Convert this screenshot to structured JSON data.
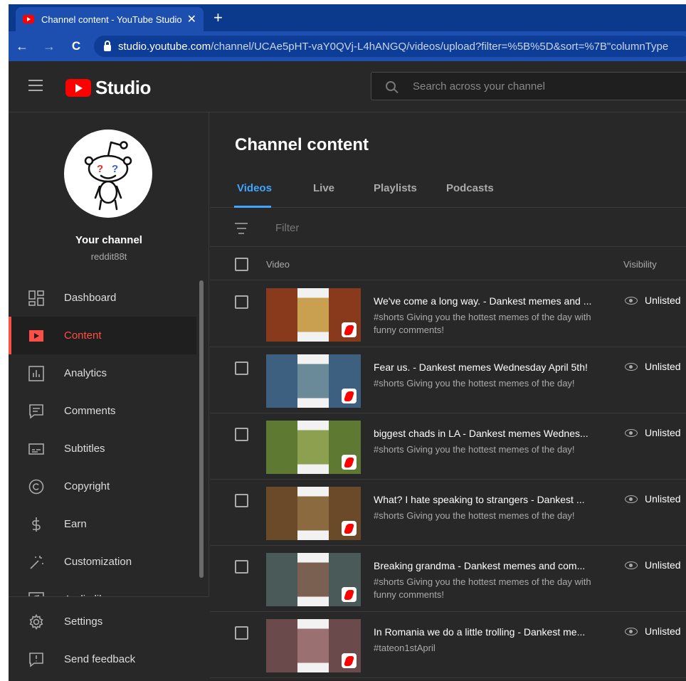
{
  "browser": {
    "tab_title": "Channel content - YouTube Studio",
    "tab_close": "✕",
    "new_tab": "+",
    "back": "←",
    "forward": "→",
    "reload": "C",
    "url_host": "studio.youtube.com",
    "url_path": "/channel/UCAe5pHT-vaY0QVj-L4hANGQ/videos/upload?filter=%5B%5D&sort=%7B\"columnType"
  },
  "header": {
    "logo_text": "Studio",
    "search_placeholder": "Search across your channel"
  },
  "channel": {
    "label": "Your channel",
    "handle": "reddit88t"
  },
  "sidebar": {
    "items": [
      {
        "label": "Dashboard",
        "icon": "dashboard-icon"
      },
      {
        "label": "Content",
        "icon": "content-icon",
        "active": true
      },
      {
        "label": "Analytics",
        "icon": "analytics-icon"
      },
      {
        "label": "Comments",
        "icon": "comments-icon"
      },
      {
        "label": "Subtitles",
        "icon": "subtitles-icon"
      },
      {
        "label": "Copyright",
        "icon": "copyright-icon"
      },
      {
        "label": "Earn",
        "icon": "earn-icon"
      },
      {
        "label": "Customization",
        "icon": "customization-icon"
      },
      {
        "label": "Audio library",
        "icon": "audio-library-icon"
      }
    ],
    "bottom": [
      {
        "label": "Settings",
        "icon": "gear-icon"
      },
      {
        "label": "Send feedback",
        "icon": "feedback-icon"
      }
    ]
  },
  "main": {
    "title": "Channel content",
    "tabs": [
      "Videos",
      "Live",
      "Playlists",
      "Podcasts"
    ],
    "active_tab": "Videos",
    "filter_placeholder": "Filter",
    "columns": {
      "video": "Video",
      "visibility": "Visibility"
    },
    "videos": [
      {
        "title": "We've come a long way. - Dankest memes and ...",
        "desc": "#shorts Giving you the hottest memes of the day with funny comments!",
        "visibility": "Unlisted",
        "thumb_color": "#8a3a1c",
        "meme_color": "#c8a050"
      },
      {
        "title": "Fear us. - Dankest memes Wednesday April 5th!",
        "desc": "#shorts Giving you the hottest memes of the day!",
        "visibility": "Unlisted",
        "thumb_color": "#3d6080",
        "meme_color": "#6a8a9a"
      },
      {
        "title": "biggest chads in LA - Dankest memes Wednes...",
        "desc": "#shorts Giving you the hottest memes of the day!",
        "visibility": "Unlisted",
        "thumb_color": "#5e7a32",
        "meme_color": "#8ca050"
      },
      {
        "title": "What? I hate speaking to strangers - Dankest ...",
        "desc": "#shorts Giving you the hottest memes of the day!",
        "visibility": "Unlisted",
        "thumb_color": "#6a4a28",
        "meme_color": "#8c6a40"
      },
      {
        "title": "Breaking grandma - Dankest memes and com...",
        "desc": "#shorts Giving you the hottest memes of the day with funny comments!",
        "visibility": "Unlisted",
        "thumb_color": "#4a5a58",
        "meme_color": "#7a6050"
      },
      {
        "title": "In Romania we do a little trolling - Dankest me...",
        "desc": "#tateon1stApril",
        "visibility": "Unlisted",
        "thumb_color": "#6a4a4a",
        "meme_color": "#9a7070"
      }
    ]
  },
  "colors": {
    "accent_red": "#ff4e45",
    "accent_blue": "#3ea6ff",
    "background": "#282828"
  }
}
